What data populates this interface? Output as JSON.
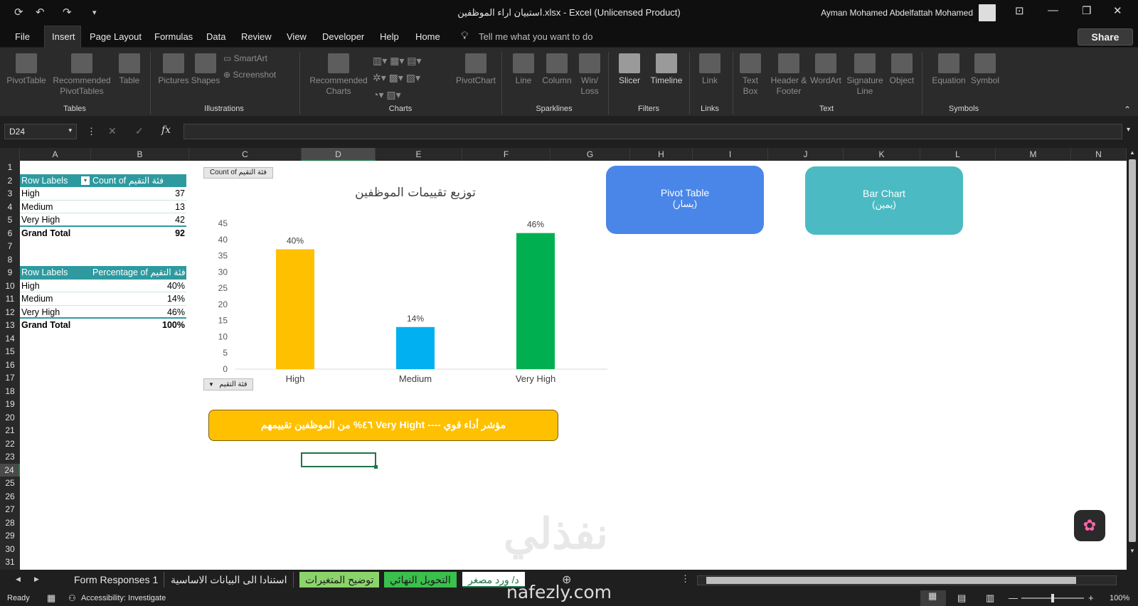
{
  "titlebar": {
    "doc_title": "استبيان اراء الموظفين.xlsx  -  Excel (Unlicensed Product)",
    "user": "Ayman Mohamed Abdelfattah Mohamed"
  },
  "menu": [
    "File",
    "Insert",
    "Page Layout",
    "Formulas",
    "Data",
    "Review",
    "View",
    "Developer",
    "Help",
    "Home"
  ],
  "tell_me": "Tell me what you want to do",
  "share": "Share",
  "ribbon": {
    "buttons": [
      {
        "label": "PivotTable"
      },
      {
        "label": "Recommended PivotTables"
      },
      {
        "label": "Table"
      },
      {
        "label": "Pictures"
      },
      {
        "label": "Shapes"
      },
      {
        "label": "SmartArt"
      },
      {
        "label": "Screenshot"
      },
      {
        "label": "Recommended Charts"
      },
      {
        "label": "PivotChart"
      },
      {
        "label": "Line"
      },
      {
        "label": "Column"
      },
      {
        "label": "Win/ Loss"
      },
      {
        "label": "Slicer"
      },
      {
        "label": "Timeline"
      },
      {
        "label": "Link"
      },
      {
        "label": "Text Box"
      },
      {
        "label": "Header & Footer"
      },
      {
        "label": "WordArt"
      },
      {
        "label": "Signature Line"
      },
      {
        "label": "Object"
      },
      {
        "label": "Equation"
      },
      {
        "label": "Symbol"
      }
    ],
    "groups": [
      "Tables",
      "Illustrations",
      "Charts",
      "Sparklines",
      "Filters",
      "Links",
      "Text",
      "Symbols"
    ]
  },
  "namebox": "D24",
  "fx": "fx",
  "columns": [
    "A",
    "B",
    "C",
    "D",
    "E",
    "F",
    "G",
    "H",
    "I",
    "J",
    "K",
    "L",
    "M",
    "N"
  ],
  "rows": [
    "1",
    "2",
    "3",
    "4",
    "5",
    "6",
    "7",
    "8",
    "9",
    "10",
    "11",
    "12",
    "13",
    "14",
    "15",
    "16",
    "17",
    "18",
    "19",
    "20",
    "21",
    "22",
    "23",
    "24",
    "25",
    "26",
    "27",
    "28",
    "29",
    "30",
    "31"
  ],
  "pivot1": {
    "h1": "Row Labels",
    "h2": "Count of فئة التقيم",
    "rows": [
      [
        "High",
        "37"
      ],
      [
        "Medium",
        "13"
      ],
      [
        "Very High",
        "42"
      ]
    ],
    "total": [
      "Grand Total",
      "92"
    ]
  },
  "pivot2": {
    "h1": "Row Labels",
    "h2": "Percentage of فئة التقيم",
    "rows": [
      [
        "High",
        "40%"
      ],
      [
        "Medium",
        "14%"
      ],
      [
        "Very High",
        "46%"
      ]
    ],
    "total": [
      "Grand Total",
      "100%"
    ]
  },
  "chart_field_btn": "Count of فئة التقيم",
  "chart_filter_btn": "فئة التقيم",
  "chart_data": {
    "type": "bar",
    "title": "توزيع تقييمات الموظفين",
    "categories": [
      "High",
      "Medium",
      "Very High"
    ],
    "values": [
      37,
      13,
      42
    ],
    "data_labels": [
      "40%",
      "14%",
      "46%"
    ],
    "colors": [
      "#ffc000",
      "#00b0f0",
      "#00b050"
    ],
    "ylim": [
      0,
      45
    ],
    "yticks": [
      "0",
      "5",
      "10",
      "15",
      "20",
      "25",
      "30",
      "35",
      "40",
      "45"
    ],
    "grid": false,
    "legend": "none"
  },
  "shape_pivot": {
    "line1": "Pivot Table",
    "line2": "(يسار)",
    "color": "#4a86e8"
  },
  "shape_bar": {
    "line1": "Bar Chart",
    "line2": "(يمين)",
    "color": "#4bbac3"
  },
  "banner": {
    "text": "٤٦% من الموظفين تقييمهم  Very Hight ---- مؤشر أداء قوي",
    "color": "#ffc000"
  },
  "sheet_tabs": [
    "Form Responses 1",
    "استنادا الى البيانات الاساسية",
    "توضيح المتغيرات",
    "التحويل النهائي",
    "د/ ورد مصغر"
  ],
  "status": {
    "ready": "Ready",
    "accessibility": "Accessibility: Investigate",
    "zoom": "100%"
  },
  "watermark": {
    "brand_ar": "نفذلي",
    "url": "nafezly.com"
  }
}
